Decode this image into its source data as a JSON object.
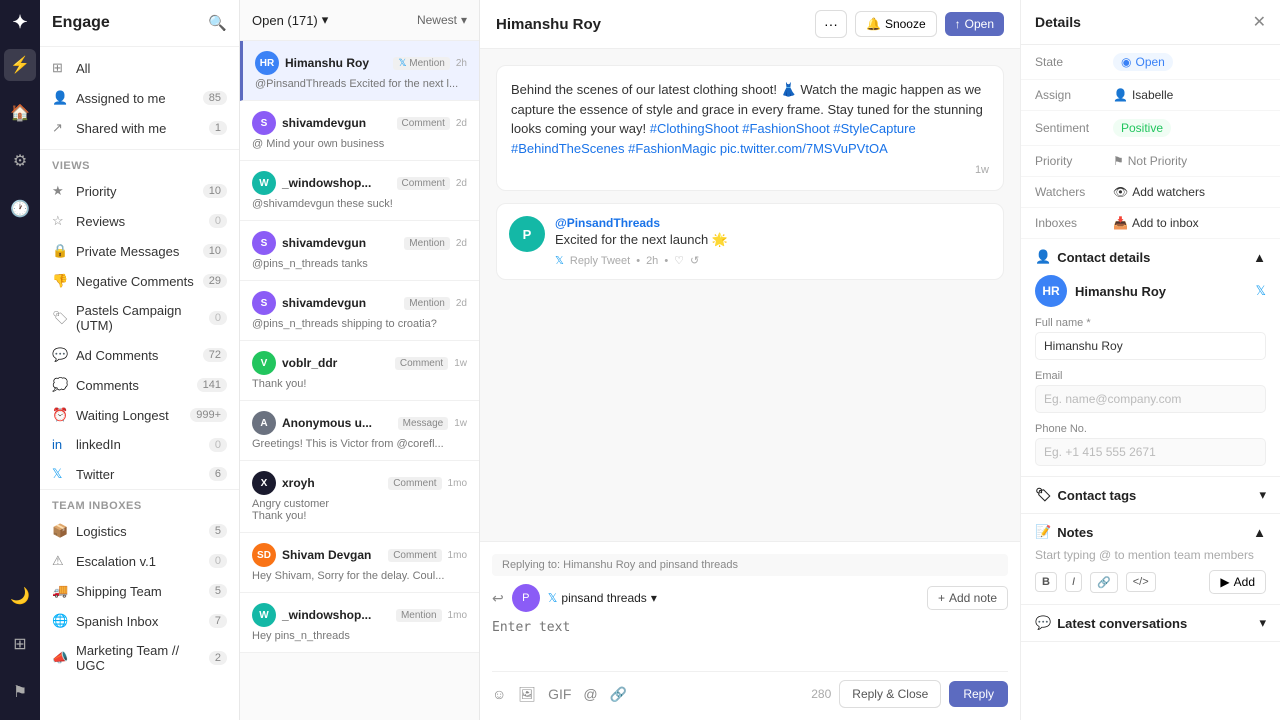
{
  "app": {
    "title": "Engage"
  },
  "sidebar": {
    "sections": [
      {
        "label": null,
        "items": [
          {
            "id": "all",
            "label": "All",
            "count": "",
            "icon": "grid"
          },
          {
            "id": "assigned",
            "label": "Assigned to me",
            "count": "85",
            "icon": "user"
          },
          {
            "id": "shared",
            "label": "Shared with me",
            "count": "1",
            "icon": "share"
          }
        ]
      }
    ],
    "views_label": "VIEWS",
    "views": [
      {
        "id": "priority",
        "label": "Priority",
        "count": "10",
        "icon": "star"
      },
      {
        "id": "reviews",
        "label": "Reviews",
        "count": "0",
        "icon": "star-outline"
      },
      {
        "id": "private",
        "label": "Private Messages",
        "count": "10",
        "icon": "lock"
      },
      {
        "id": "negative",
        "label": "Negative Comments",
        "count": "29",
        "icon": "thumb-down"
      },
      {
        "id": "pastels",
        "label": "Pastels Campaign (UTM)",
        "count": "0",
        "icon": "tag"
      },
      {
        "id": "ad-comments",
        "label": "Ad Comments",
        "count": "72",
        "icon": "comment"
      },
      {
        "id": "comments",
        "label": "Comments",
        "count": "141",
        "icon": "chat"
      },
      {
        "id": "waiting",
        "label": "Waiting Longest",
        "count": "999+",
        "icon": "clock"
      },
      {
        "id": "linkedin",
        "label": "linkedIn",
        "count": "0",
        "icon": "linkedin"
      },
      {
        "id": "twitter",
        "label": "Twitter",
        "count": "6",
        "icon": "twitter"
      }
    ],
    "team_label": "TEAM INBOXES",
    "team": [
      {
        "id": "logistics",
        "label": "Logistics",
        "count": "5",
        "icon": "box"
      },
      {
        "id": "escalation",
        "label": "Escalation v.1",
        "count": "0",
        "icon": "alert"
      },
      {
        "id": "shipping",
        "label": "Shipping Team",
        "count": "5",
        "icon": "truck"
      },
      {
        "id": "spanish",
        "label": "Spanish Inbox",
        "count": "7",
        "icon": "globe"
      },
      {
        "id": "marketing",
        "label": "Marketing Team // UGC",
        "count": "2",
        "icon": "megaphone"
      }
    ]
  },
  "conv_list": {
    "filter_label": "Open (171)",
    "sort_label": "Newest",
    "items": [
      {
        "id": 1,
        "name": "Himanshu Roy",
        "type": "Mention",
        "preview": "@PinsandThreads Excited for the next l...",
        "time": "2h",
        "avatar_initials": "HR",
        "avatar_color": "av-blue",
        "active": true
      },
      {
        "id": 2,
        "name": "shivamdevgun",
        "type": "Comment",
        "preview": "@ Mind your own business",
        "time": "2d",
        "avatar_initials": "S",
        "avatar_color": "av-purple"
      },
      {
        "id": 3,
        "name": "_windowshop...",
        "type": "Comment",
        "preview": "@shivamdevgun these suck!",
        "time": "2d",
        "avatar_initials": "W",
        "avatar_color": "av-teal"
      },
      {
        "id": 4,
        "name": "shivamdevgun",
        "type": "Mention",
        "preview": "@pins_n_threads tanks",
        "time": "2d",
        "avatar_initials": "S",
        "avatar_color": "av-purple"
      },
      {
        "id": 5,
        "name": "shivamdevgun",
        "type": "Mention",
        "preview": "@pins_n_threads shipping to croatia?",
        "time": "2d",
        "avatar_initials": "S",
        "avatar_color": "av-purple"
      },
      {
        "id": 6,
        "name": "voblr_ddr",
        "type": "Comment",
        "preview": "Thank you!",
        "time": "1w",
        "avatar_initials": "V",
        "avatar_color": "av-green"
      },
      {
        "id": 7,
        "name": "Anonymous u...",
        "type": "Message",
        "preview": "Greetings! This is Victor from @corefl...",
        "time": "1w",
        "avatar_initials": "A",
        "avatar_color": "av-gray"
      },
      {
        "id": 8,
        "name": "xroyh",
        "type": "Comment",
        "preview": "Angry customer Thank you!",
        "time": "1mo",
        "avatar_initials": "X",
        "avatar_color": "av-dark"
      },
      {
        "id": 9,
        "name": "Shivam Devgan",
        "type": "Comment",
        "preview": "Hey Shivam, Sorry for the delay. Coul...",
        "time": "1mo",
        "avatar_initials": "SD",
        "avatar_color": "av-orange"
      },
      {
        "id": 10,
        "name": "_windowshop...",
        "type": "Mention",
        "preview": "Hey pins_n_threads",
        "time": "1mo",
        "avatar_initials": "W",
        "avatar_color": "av-teal"
      }
    ]
  },
  "main": {
    "title": "Himanshu Roy",
    "btn_dots": "···",
    "btn_snooze": "Snooze",
    "btn_open": "Open",
    "tweet_text": "Behind the scenes of our latest clothing shoot! 👗 Watch the magic happen as we capture the essence of style and grace in every frame. Stay tuned for the stunning looks coming your way! #ClothingShoot #FashionShoot #StyleCapture #BehindTheScenes #FashionMagic pic.twitter.com/7MSVuPVtOA",
    "tweet_time": "1w",
    "reply_user": "@PinsandThreads",
    "reply_text": "Excited for the next launch 🌟",
    "reply_meta_tweet": "Reply Tweet",
    "reply_meta_time": "2h"
  },
  "reply_box": {
    "replying_to": "Replying to: Himanshu Roy and pinsand threads",
    "account_name": "pinsand threads",
    "add_note_label": "Add note",
    "placeholder": "Enter text",
    "char_count": "280",
    "reply_close_label": "Reply & Close",
    "reply_label": "Reply"
  },
  "details": {
    "title": "Details",
    "state_label": "State",
    "state_value": "Open",
    "assign_label": "Assign",
    "assign_value": "Isabelle",
    "sentiment_label": "Sentiment",
    "sentiment_value": "Positive",
    "priority_label": "Priority",
    "priority_value": "Not Priority",
    "watchers_label": "Watchers",
    "watchers_value": "Add watchers",
    "inboxes_label": "Inboxes",
    "inboxes_value": "Add to inbox",
    "contact_section": "Contact details",
    "contact_name": "Himanshu Roy",
    "full_name_label": "Full name *",
    "email_label": "Email",
    "email_placeholder": "Eg. name@company.com",
    "phone_label": "Phone No.",
    "phone_placeholder": "Eg. +1 415 555 2671",
    "contact_tags_label": "Contact tags",
    "notes_label": "Notes",
    "notes_placeholder": "Start typing @ to mention team members",
    "notes_add_label": "Add",
    "latest_conv_label": "Latest conversations"
  }
}
